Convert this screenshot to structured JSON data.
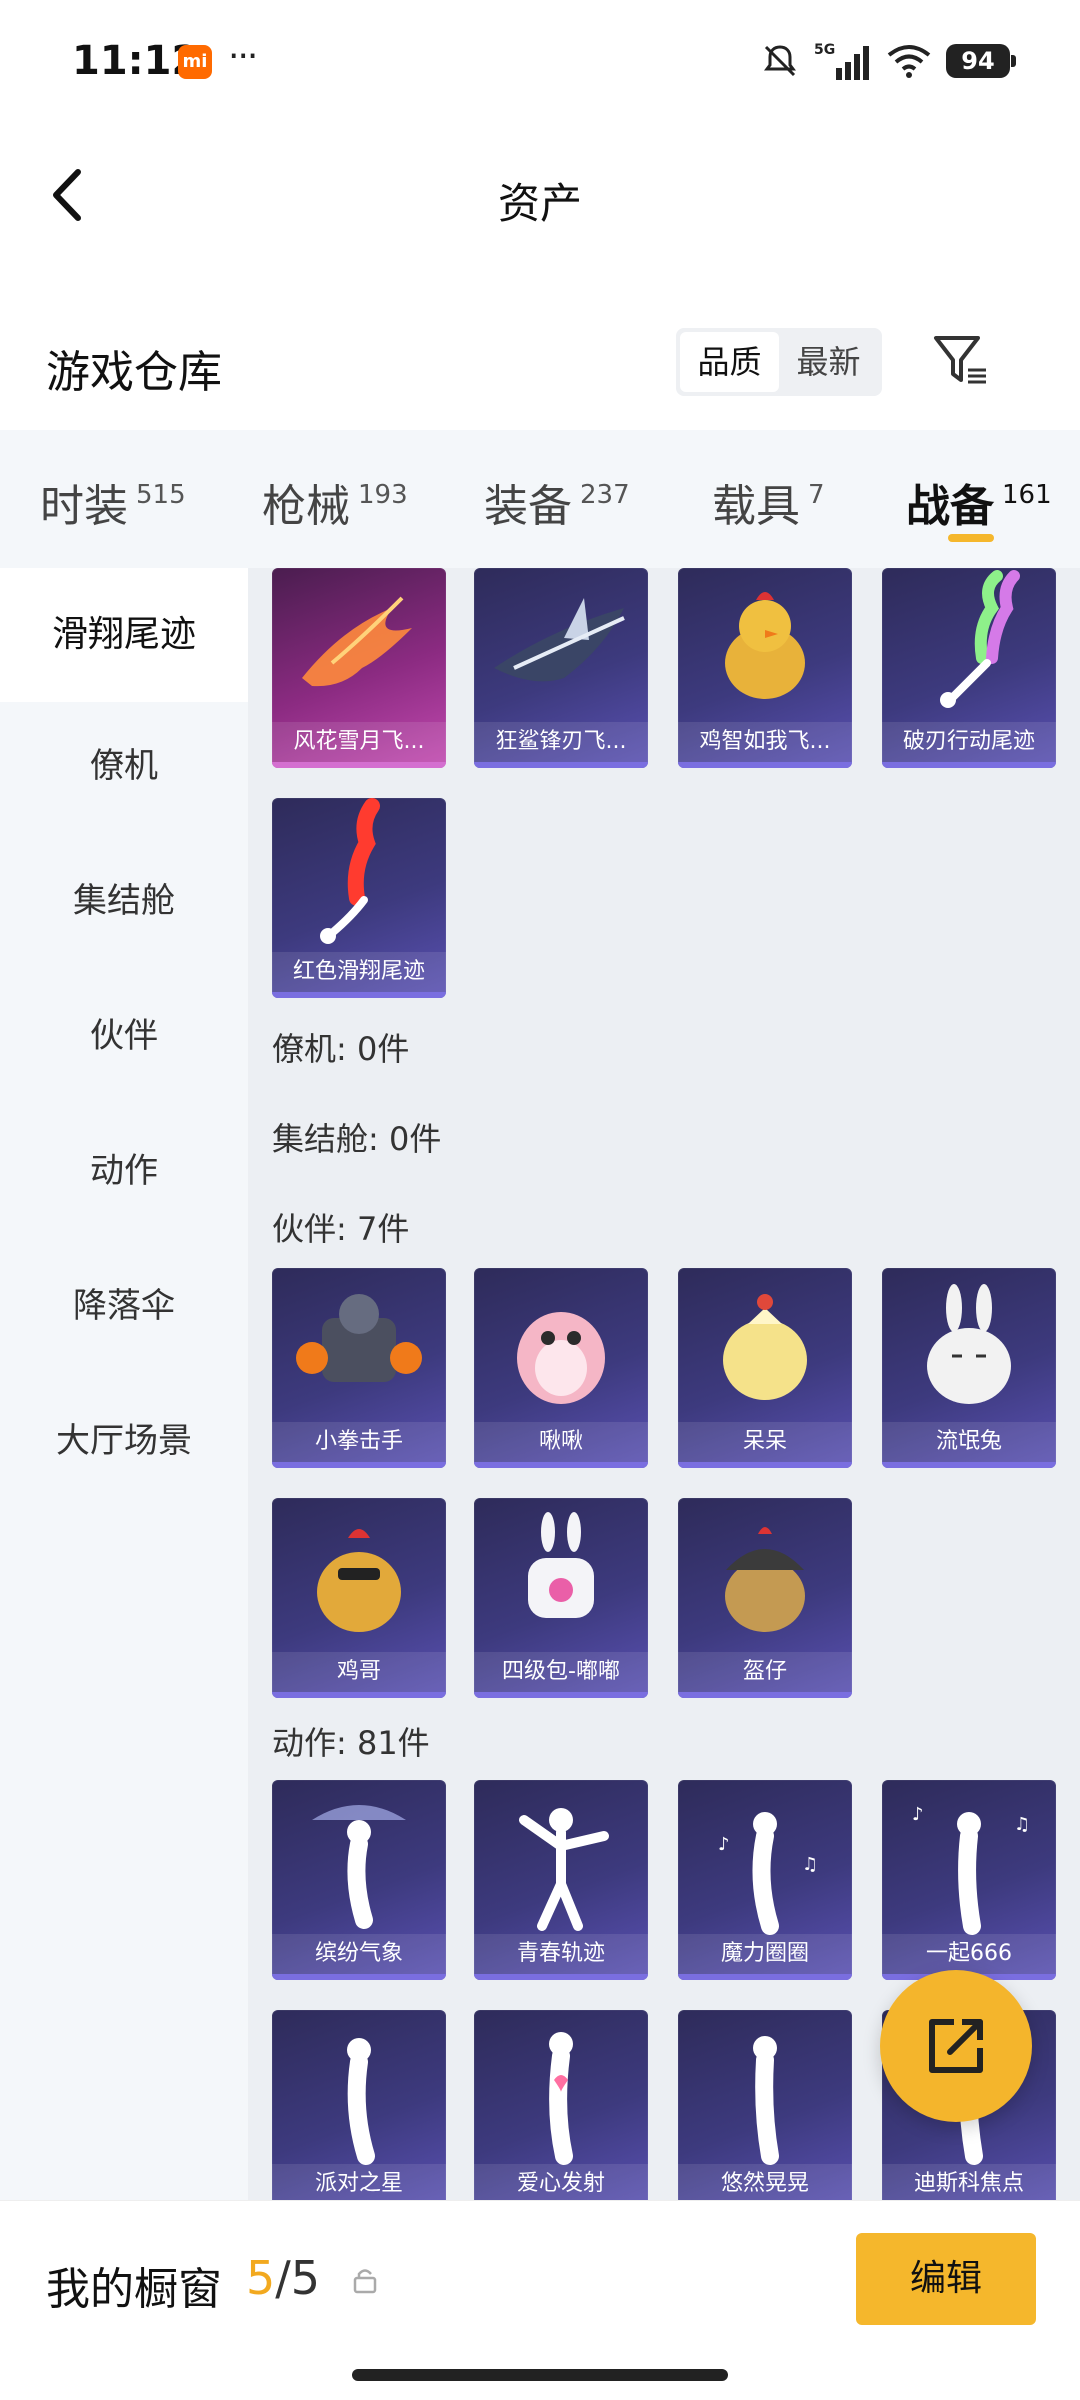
{
  "status": {
    "time": "11:12",
    "mi_badge": "mi",
    "dots": "···",
    "network": "5G",
    "battery": "94"
  },
  "header": {
    "title": "资产"
  },
  "warehouse": {
    "title": "游戏仓库",
    "sort_options": [
      "品质",
      "最新"
    ],
    "active_sort": "品质"
  },
  "category_tabs": [
    {
      "label": "时装",
      "count": "515"
    },
    {
      "label": "枪械",
      "count": "193"
    },
    {
      "label": "装备",
      "count": "237"
    },
    {
      "label": "载具",
      "count": "7"
    },
    {
      "label": "战备",
      "count": "161",
      "active": true
    }
  ],
  "sidebar": {
    "items": [
      "滑翔尾迹",
      "僚机",
      "集结舱",
      "伙伴",
      "动作",
      "降落伞",
      "大厅场景"
    ],
    "active": "滑翔尾迹"
  },
  "content": {
    "glide_trails": [
      "风花雪月飞...",
      "狂鲨锋刃飞...",
      "鸡智如我飞...",
      "破刃行动尾迹",
      "红色滑翔尾迹"
    ],
    "section_wingman": "僚机: 0件",
    "section_capsule": "集结舱: 0件",
    "section_partner": "伙伴: 7件",
    "partners": [
      "小拳击手",
      "啾啾",
      "呆呆",
      "流氓兔",
      "鸡哥",
      "四级包-嘟嘟",
      "盔仔"
    ],
    "section_action": "动作: 81件",
    "actions": [
      "缤纷气象",
      "青春轨迹",
      "魔力圈圈",
      "一起666",
      "派对之星",
      "爱心发射",
      "悠然晃晃",
      "迪斯科焦点"
    ]
  },
  "bottom": {
    "window_title": "我的橱窗",
    "current": "5",
    "total": "/5",
    "edit_label": "编辑"
  },
  "colors": {
    "accent": "#f5b72c",
    "card_purple": "#3d3a7e",
    "card_pink": "#8c2b82"
  }
}
